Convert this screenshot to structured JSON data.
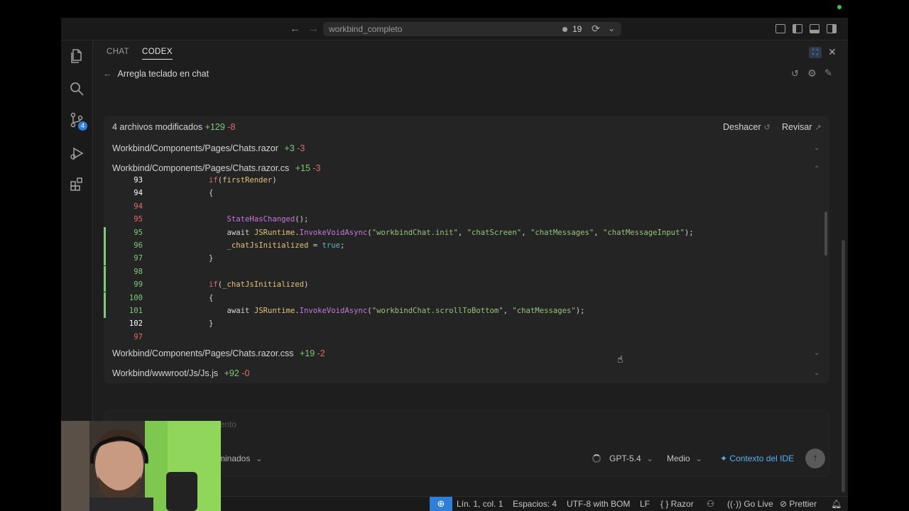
{
  "titlebar": {
    "search_title": "workbind_completo",
    "notif_count": "19",
    "back_glyph": "←",
    "forward_glyph": "→"
  },
  "tabs": {
    "chat": "CHAT",
    "codex": "CODEX"
  },
  "thread": {
    "back_glyph": "←",
    "title": "Arregla teclado en chat"
  },
  "summary": {
    "label": "4 archivos modificados",
    "added": "+129",
    "removed": "-8",
    "undo": "Deshacer",
    "undo_glyph": "↺",
    "review": "Revisar",
    "review_glyph": "↗"
  },
  "files": [
    {
      "path": "Workbind/Components/Pages/Chats.razor",
      "added": "+3",
      "removed": "-3",
      "chevron": "⌄"
    },
    {
      "path": "Workbind/Components/Pages/Chats.razor.cs",
      "added": "+15",
      "removed": "-3",
      "chevron": "⌃"
    },
    {
      "path": "Workbind/Components/Pages/Chats.razor.css",
      "added": "+19",
      "removed": "-2",
      "chevron": "⌄"
    },
    {
      "path": "Workbind/wwwroot/Js/Js.js",
      "added": "+92",
      "removed": "-0",
      "chevron": "⌄"
    }
  ],
  "diff_lines": [
    {
      "num": "93",
      "kind": "cur",
      "parts": [
        [
          "kw",
          "if"
        ],
        [
          "",
          "("
        ],
        [
          "id",
          "firstRender"
        ],
        [
          "",
          ")"
        ]
      ],
      "indent": 8
    },
    {
      "num": "94",
      "kind": "cur",
      "parts": [
        [
          "",
          "{"
        ]
      ],
      "indent": 8
    },
    {
      "num": "94",
      "kind": "old",
      "parts": [],
      "indent": 8
    },
    {
      "num": "95",
      "kind": "old",
      "parts": [
        [
          "fn",
          "StateHasChanged"
        ],
        [
          "",
          "();"
        ]
      ],
      "indent": 12
    },
    {
      "num": "95",
      "kind": "new",
      "parts": [
        [
          "",
          "await "
        ],
        [
          "id",
          "JSRuntime"
        ],
        [
          "",
          "."
        ],
        [
          "fn",
          "InvokeVoidAsync"
        ],
        [
          "",
          "("
        ],
        [
          "str",
          "\"workbindChat.init\""
        ],
        [
          "",
          ", "
        ],
        [
          "str",
          "\"chatScreen\""
        ],
        [
          "",
          ", "
        ],
        [
          "str",
          "\"chatMessages\""
        ],
        [
          "",
          ", "
        ],
        [
          "str",
          "\"chatMessageInput\""
        ],
        [
          "",
          ");"
        ]
      ],
      "indent": 12
    },
    {
      "num": "96",
      "kind": "new",
      "parts": [
        [
          "id",
          "_chatJsInitialized"
        ],
        [
          "",
          " = "
        ],
        [
          "bool",
          "true"
        ],
        [
          "",
          ";"
        ]
      ],
      "indent": 12
    },
    {
      "num": "97",
      "kind": "new",
      "parts": [
        [
          "",
          "}"
        ]
      ],
      "indent": 8
    },
    {
      "num": "98",
      "kind": "new",
      "parts": [],
      "indent": 8
    },
    {
      "num": "99",
      "kind": "new",
      "parts": [
        [
          "kw",
          "if"
        ],
        [
          "",
          "("
        ],
        [
          "id",
          "_chatJsInitialized"
        ],
        [
          "",
          ")"
        ]
      ],
      "indent": 8
    },
    {
      "num": "100",
      "kind": "new",
      "parts": [
        [
          "",
          "{"
        ]
      ],
      "indent": 8
    },
    {
      "num": "101",
      "kind": "new",
      "parts": [
        [
          "",
          "await "
        ],
        [
          "id",
          "JSRuntime"
        ],
        [
          "",
          "."
        ],
        [
          "fn",
          "InvokeVoidAsync"
        ],
        [
          "",
          "("
        ],
        [
          "str",
          "\"workbindChat.scrollToBottom\""
        ],
        [
          "",
          ", "
        ],
        [
          "str",
          "\"chatMessages\""
        ],
        [
          "",
          ");"
        ]
      ],
      "indent": 12
    },
    {
      "num": "102",
      "kind": "cur",
      "parts": [
        [
          "",
          "}"
        ]
      ],
      "indent": 8
    },
    {
      "num": "97",
      "kind": "old",
      "parts": [],
      "indent": 8
    }
  ],
  "composer": {
    "placeholder": "...iento",
    "mode": "...minados",
    "model": "GPT-5.4",
    "effort": "Medio",
    "context": "Contexto del IDE",
    "send_glyph": "↑",
    "dropdown_glyph": "⌄"
  },
  "statusbar": {
    "position": "Lín. 1, col. 1",
    "spaces": "Espacios: 4",
    "encoding": "UTF-8 with BOM",
    "eol": "LF",
    "language": "{ }  Razor",
    "golive": "Go Live",
    "prettier": "Prettier"
  },
  "activity_badge": "4",
  "colors": {
    "accent": "#2f7fd6",
    "added": "#7fc97f",
    "removed": "#e06c6c",
    "context_link": "#5ab0f0"
  }
}
